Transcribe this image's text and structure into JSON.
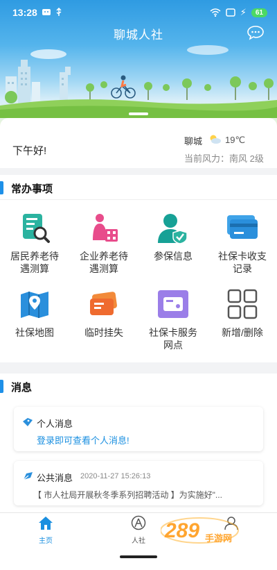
{
  "status_bar": {
    "time": "13:28",
    "battery": "61"
  },
  "app": {
    "title": "聊城人社"
  },
  "greeting": {
    "text": "下午好!"
  },
  "weather": {
    "city": "聊城",
    "temp": "19℃",
    "wind": "当前风力：南风 2级"
  },
  "services": {
    "title": "常办事项",
    "items": [
      {
        "label": "居民养老待\n遇测算",
        "icon": "resident-pension-calc-icon"
      },
      {
        "label": "企业养老待\n遇测算",
        "icon": "enterprise-pension-calc-icon"
      },
      {
        "label": "参保信息",
        "icon": "insurance-info-icon"
      },
      {
        "label": "社保卡收支\n记录",
        "icon": "card-records-icon"
      },
      {
        "label": "社保地图",
        "icon": "map-icon"
      },
      {
        "label": "临时挂失",
        "icon": "report-loss-icon"
      },
      {
        "label": "社保卡服务\n网点",
        "icon": "service-outlet-icon"
      },
      {
        "label": "新增/删除",
        "icon": "grid-edit-icon"
      }
    ]
  },
  "messages": {
    "title": "消息",
    "personal": {
      "title": "个人消息",
      "link": "登录即可查看个人消息!"
    },
    "public": {
      "title": "公共消息",
      "date": "2020-11-27 15:26:13",
      "snippet": "【 市人社局开展秋冬季系列招聘活动 】为实施好\"..."
    }
  },
  "nav": {
    "home": "主页",
    "renshe": "人社"
  },
  "watermark": {
    "number": "289",
    "site": "手游网"
  },
  "colors": {
    "accent": "#1a8fe0",
    "brand_blue": "#2f9be2"
  }
}
